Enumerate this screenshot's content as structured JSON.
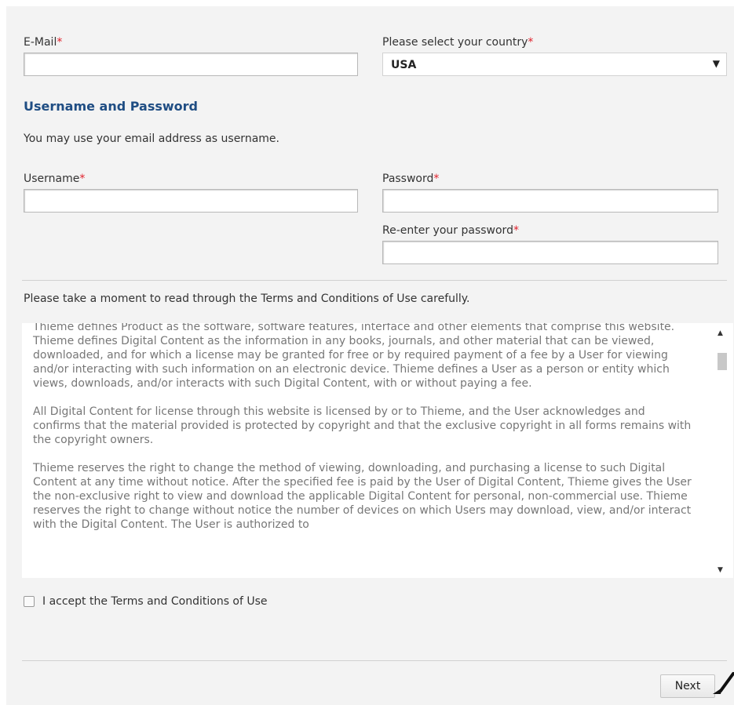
{
  "form": {
    "email_label": "E-Mail",
    "country_label": "Please select your country",
    "country_value": "USA",
    "required_mark": "*",
    "section_title": "Username and Password",
    "section_hint": "You may use your email address as username.",
    "username_label": "Username",
    "password_label": "Password",
    "reenter_label": "Re-enter your password"
  },
  "terms": {
    "intro": "Please take a moment to read through the Terms and Conditions of Use carefully.",
    "paragraphs": [
      "Thieme defines Product as the software, software features, interface and other elements that comprise this website. Thieme defines Digital Content as the information in any books, journals, and other material that can be viewed, downloaded, and for which a license may be granted for free or by required payment of a fee by a User for viewing and/or interacting with such information on an electronic device. Thieme defines a User as a person or entity which views, downloads, and/or interacts with such Digital Content, with or without paying a fee.",
      "All Digital Content for license through this website is licensed by or to Thieme, and the User acknowledges and confirms that the material provided is protected by copyright and that the exclusive copyright in all forms remains with the copyright owners.",
      "Thieme reserves the right to change the method of viewing, downloading, and purchasing a license to such Digital Content at any time without notice. After the specified fee is paid by the User of Digital Content, Thieme gives the User the non-exclusive right to view and download the applicable Digital Content for personal, non-commercial use. Thieme reserves the right to change without notice the number of devices on which Users may download, view, and/or interact with the Digital Content. The User is authorized to"
    ],
    "accept_label": "I accept the Terms and Conditions of Use"
  },
  "actions": {
    "next_label": "Next"
  },
  "icons": {
    "dropdown": "caret-down-icon",
    "scroll_up": "scroll-up-arrow-icon",
    "scroll_down": "scroll-down-arrow-icon",
    "cursor": "mouse-pointer-icon"
  }
}
